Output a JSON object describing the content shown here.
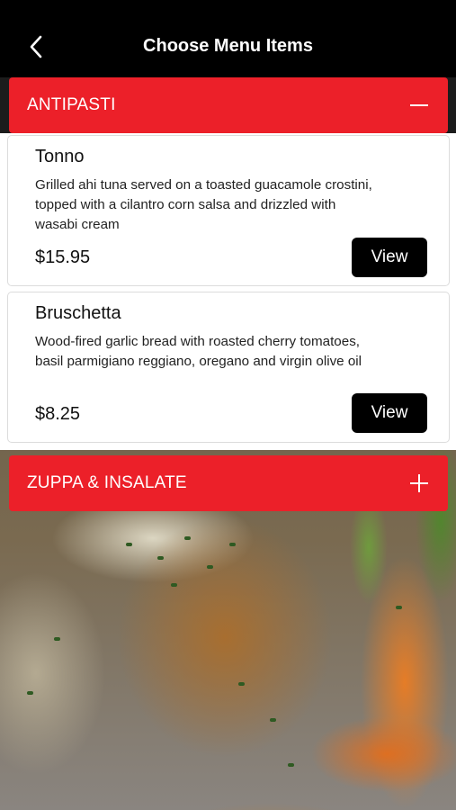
{
  "header": {
    "title": "Choose Menu Items",
    "back_icon": "chevron-left-icon"
  },
  "colors": {
    "nav_background": "#000000",
    "section_accent": "#ec2029",
    "button_background": "#000000",
    "card_background": "#ffffff"
  },
  "sections": [
    {
      "title": "ANTIPASTI",
      "state": "expanded",
      "toggle_icon": "minus-icon",
      "items": [
        {
          "name": "Tonno",
          "description": "Grilled ahi tuna served on a toasted guacamole crostini, topped with a cilantro corn salsa and drizzled with wasabi cream",
          "price": "$15.95",
          "button_label": "View"
        },
        {
          "name": "Bruschetta",
          "description": "Wood-fired garlic bread with roasted cherry tomatoes, basil parmigiano reggiano, oregano and virgin olive oil",
          "price": "$8.25",
          "button_label": "View"
        }
      ]
    },
    {
      "title": "ZUPPA & INSALATE",
      "state": "collapsed",
      "toggle_icon": "plus-icon"
    }
  ]
}
